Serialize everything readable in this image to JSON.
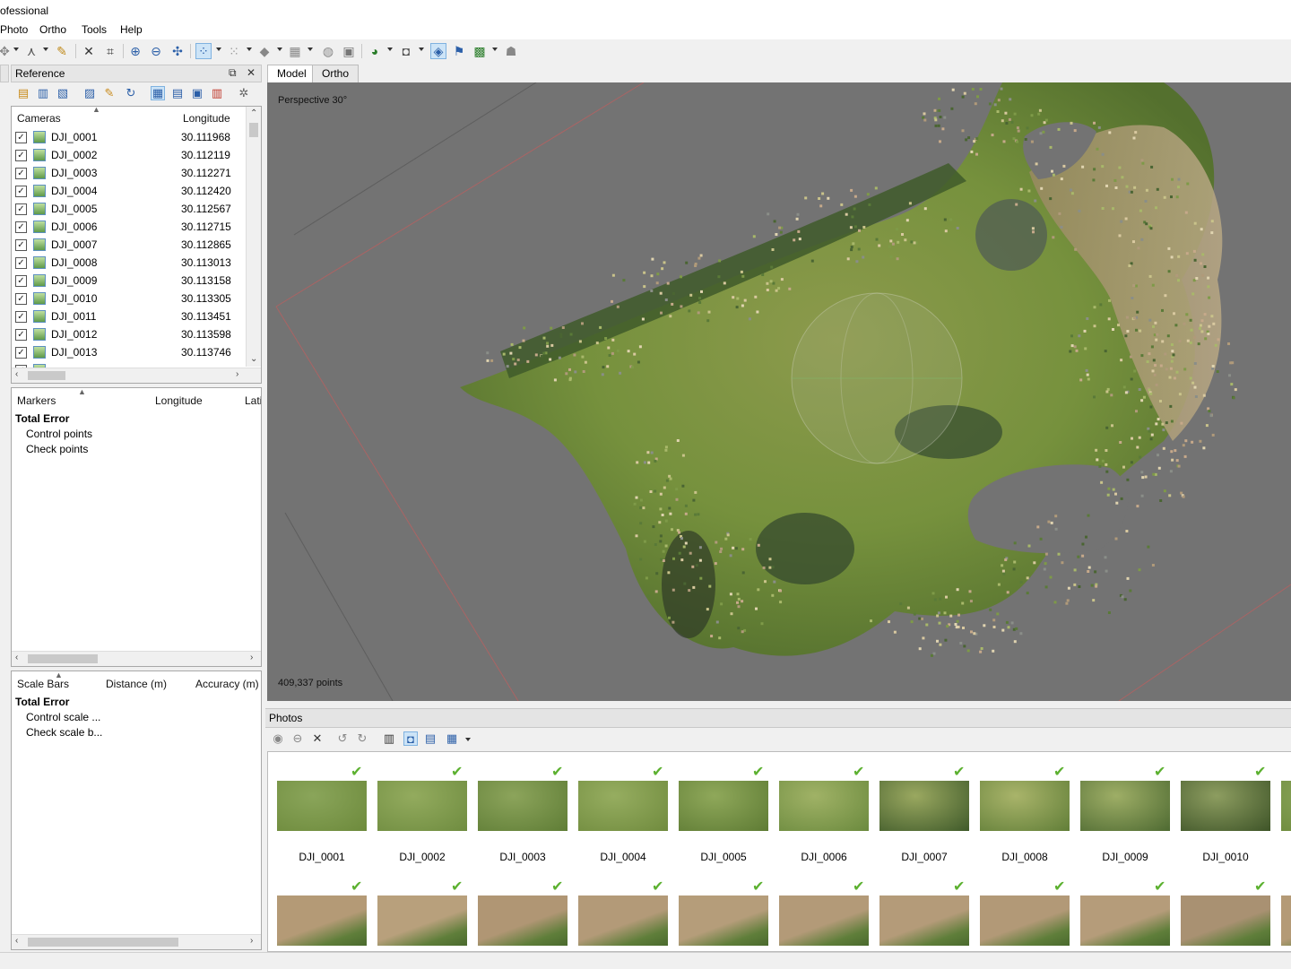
{
  "window": {
    "title": "ofessional"
  },
  "menu": [
    "Photo",
    "Ortho",
    "Tools",
    "Help"
  ],
  "reference_panel": {
    "title": "Reference",
    "cameras": {
      "columns": [
        "Cameras",
        "Longitude"
      ],
      "rows": [
        {
          "name": "DJI_0001",
          "lon": "30.111968"
        },
        {
          "name": "DJI_0002",
          "lon": "30.112119"
        },
        {
          "name": "DJI_0003",
          "lon": "30.112271"
        },
        {
          "name": "DJI_0004",
          "lon": "30.112420"
        },
        {
          "name": "DJI_0005",
          "lon": "30.112567"
        },
        {
          "name": "DJI_0006",
          "lon": "30.112715"
        },
        {
          "name": "DJI_0007",
          "lon": "30.112865"
        },
        {
          "name": "DJI_0008",
          "lon": "30.113013"
        },
        {
          "name": "DJI_0009",
          "lon": "30.113158"
        },
        {
          "name": "DJI_0010",
          "lon": "30.113305"
        },
        {
          "name": "DJI_0011",
          "lon": "30.113451"
        },
        {
          "name": "DJI_0012",
          "lon": "30.113598"
        },
        {
          "name": "DJI_0013",
          "lon": "30.113746"
        }
      ]
    },
    "markers": {
      "columns": [
        "Markers",
        "Longitude",
        "Lati"
      ],
      "total": "Total Error",
      "items": [
        "Control points",
        "Check points"
      ]
    },
    "scalebars": {
      "columns": [
        "Scale Bars",
        "Distance (m)",
        "Accuracy (m)"
      ],
      "total": "Total Error",
      "items": [
        "Control scale ...",
        "Check scale b..."
      ]
    }
  },
  "view": {
    "tabs": [
      "Model",
      "Ortho"
    ],
    "active_tab": "Model",
    "projection_label": "Perspective 30°",
    "points_label": "409,337 points",
    "background_color": "#737373"
  },
  "photos": {
    "title": "Photos",
    "row1": [
      "DJI_0001",
      "DJI_0002",
      "DJI_0003",
      "DJI_0004",
      "DJI_0005",
      "DJI_0006",
      "DJI_0007",
      "DJI_0008",
      "DJI_0009",
      "DJI_0010"
    ],
    "check_color": "#5cb130"
  }
}
